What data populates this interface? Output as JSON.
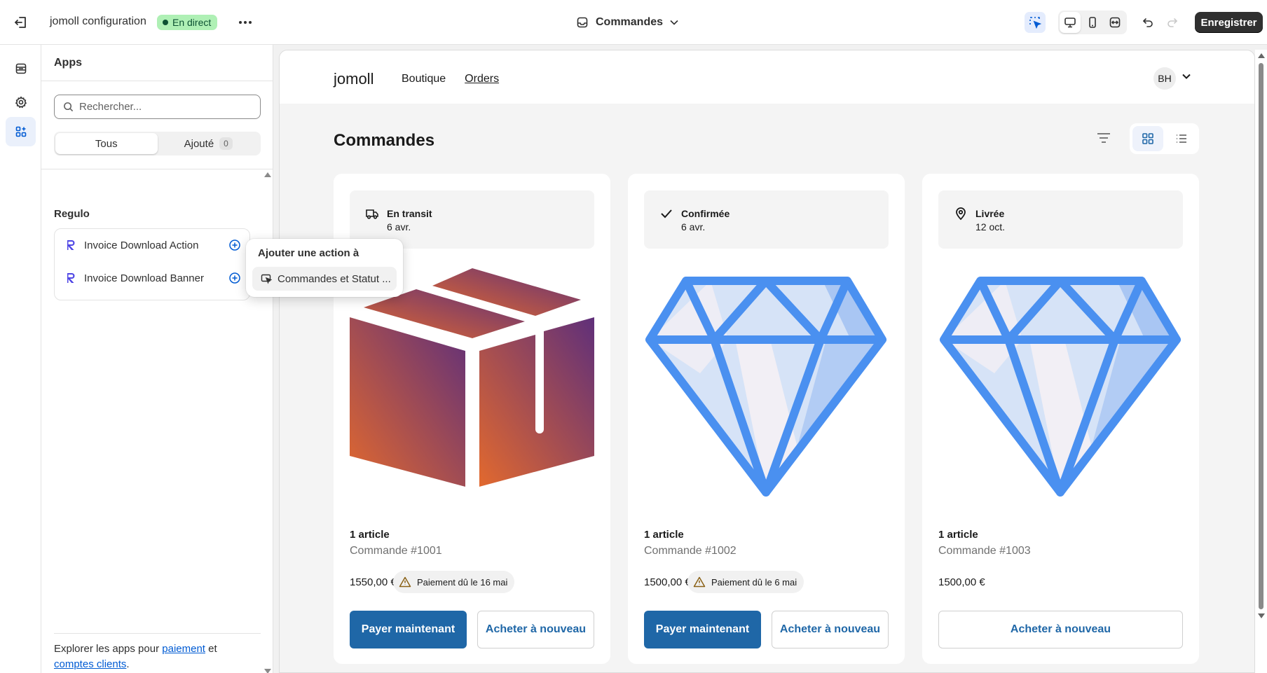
{
  "topbar": {
    "app_title": "jomoll configuration",
    "live_badge": "En direct",
    "page_selector": "Commandes",
    "save_label": "Enregistrer"
  },
  "panel": {
    "title": "Apps",
    "search_placeholder": "Rechercher...",
    "tabs": [
      {
        "label": "Tous"
      },
      {
        "label": "Ajouté",
        "count": "0"
      }
    ],
    "group_title": "Regulo",
    "apps": [
      {
        "name": "Invoice Download Action"
      },
      {
        "name": "Invoice Download Banner"
      }
    ],
    "footer": {
      "prefix": "Explorer les apps pour",
      "link1": "paiement",
      "middle": "et",
      "link2": "comptes clients",
      "suffix": "."
    }
  },
  "popover": {
    "title": "Ajouter une action à",
    "item": "Commandes et Statut ..."
  },
  "store": {
    "logo": "jomoll",
    "nav": [
      "Boutique",
      "Orders"
    ],
    "avatar": "BH",
    "page_title": "Commandes"
  },
  "orders": [
    {
      "status": "En transit",
      "date": "6 avr.",
      "count": "1 article",
      "order_number": "Commande #1001",
      "price": "1550,00 €",
      "due": "Paiement dû le 16 mai",
      "pay_label": "Payer maintenant",
      "reorder_label": "Acheter à nouveau"
    },
    {
      "status": "Confirmée",
      "date": "6 avr.",
      "count": "1 article",
      "order_number": "Commande #1002",
      "price": "1500,00 €",
      "due": "Paiement dû le 6 mai",
      "pay_label": "Payer maintenant",
      "reorder_label": "Acheter à nouveau"
    },
    {
      "status": "Livrée",
      "date": "12 oct.",
      "count": "1 article",
      "order_number": "Commande #1003",
      "price": "1500,00 €",
      "reorder_label": "Acheter à nouveau"
    }
  ],
  "colors": {
    "accent": "#1f67a7",
    "live": "#aff0b5",
    "diamond": "#4a90f0",
    "link": "#005bd3"
  }
}
